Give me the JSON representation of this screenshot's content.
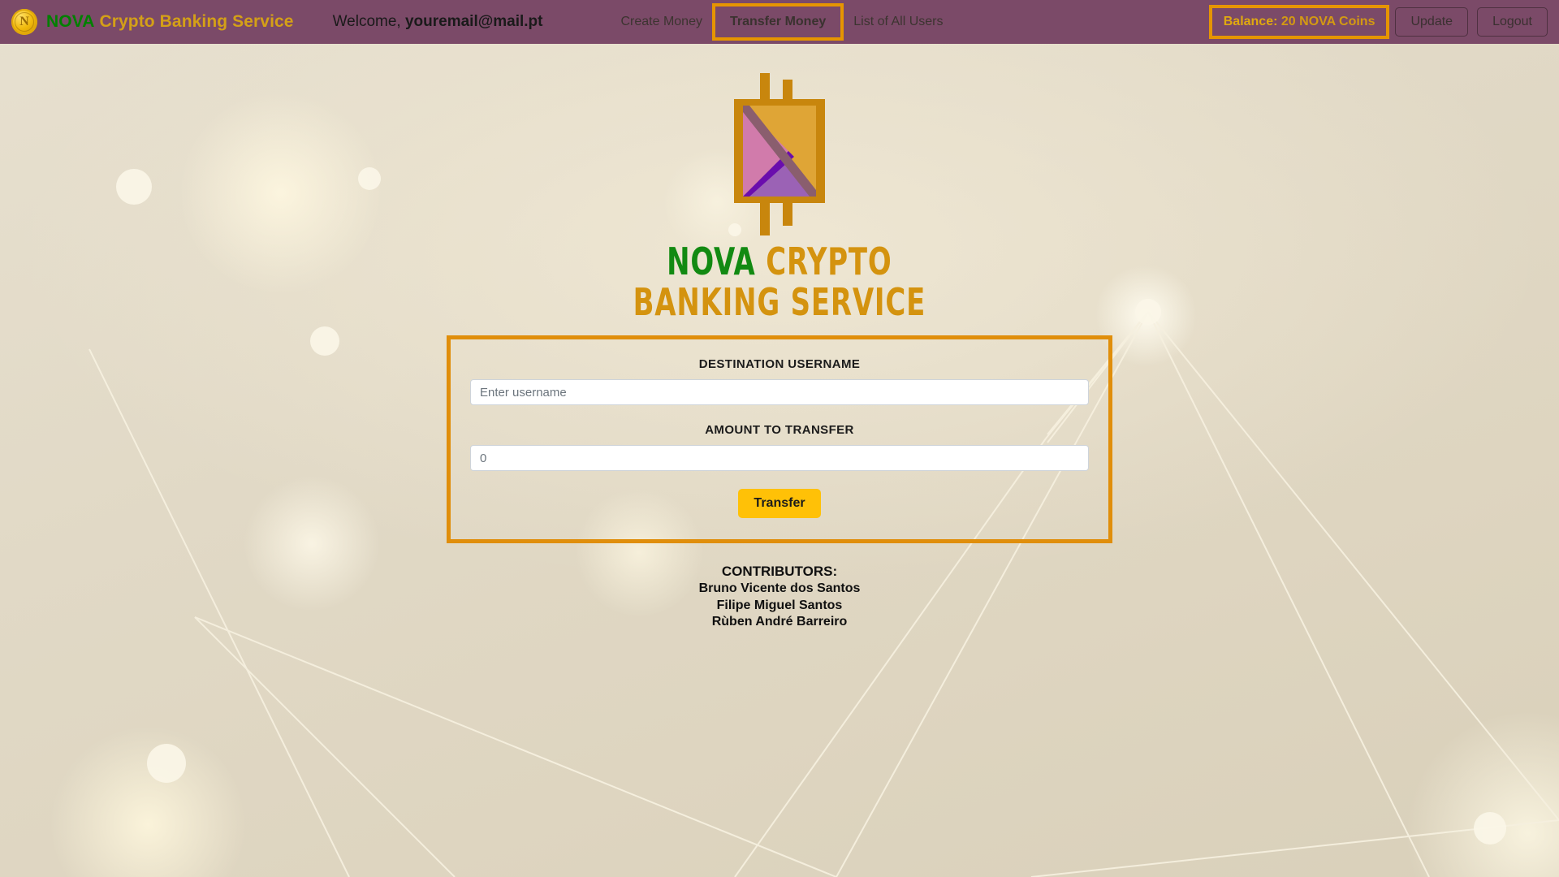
{
  "header": {
    "coin_icon": "nova-coin-icon",
    "brand_prefix": "NOVA",
    "brand_rest": "Crypto Banking Service",
    "welcome_prefix": "Welcome, ",
    "welcome_user": "youremail@mail.pt",
    "nav_items": [
      {
        "label": "Create Money",
        "highlighted": false
      },
      {
        "label": "Transfer Money",
        "highlighted": true
      },
      {
        "label": "List of All Users",
        "highlighted": false
      }
    ],
    "balance_label": "Balance:",
    "balance_value": "20 NOVA Coins",
    "update_label": "Update",
    "logout_label": "Logout"
  },
  "hero": {
    "logo_icon": "nova-bitcoin-tangram-logo",
    "title_line1_green": "NOVA",
    "title_line1_rest": "CRYPTO",
    "title_line2": "BANKING SERVICE"
  },
  "form": {
    "username_label": "DESTINATION USERNAME",
    "username_value": "",
    "username_placeholder": "Enter username",
    "amount_label": "AMOUNT TO TRANSFER",
    "amount_value": "",
    "amount_placeholder": "0",
    "submit_label": "Transfer"
  },
  "contributors": {
    "heading_bold": "CONTRIBUTORS",
    "heading_suffix": ":",
    "names": [
      "Bruno Vicente dos Santos",
      "Filipe Miguel Santos",
      "Rùben André Barreiro"
    ]
  },
  "colors": {
    "navbar_purple": "#7b4a68",
    "highlight_orange": "#e69500",
    "brand_gold": "#d4a017",
    "brand_green": "#008000",
    "title_gold": "#d4930f",
    "button_yellow": "#ffc107",
    "page_beige": "#e3dcca"
  }
}
